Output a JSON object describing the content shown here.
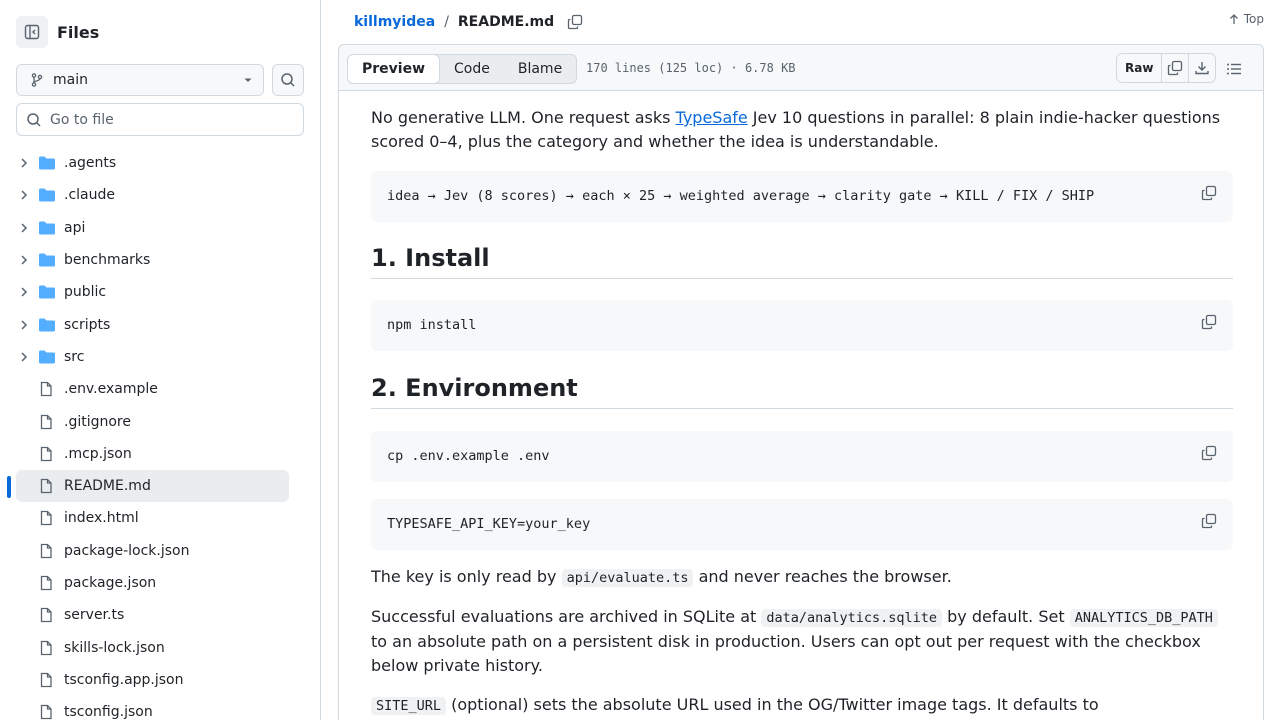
{
  "sidebar": {
    "title": "Files",
    "branch": "main",
    "goto_placeholder": "Go to file",
    "items": [
      {
        "name": ".agents",
        "type": "folder"
      },
      {
        "name": ".claude",
        "type": "folder"
      },
      {
        "name": "api",
        "type": "folder"
      },
      {
        "name": "benchmarks",
        "type": "folder"
      },
      {
        "name": "public",
        "type": "folder"
      },
      {
        "name": "scripts",
        "type": "folder"
      },
      {
        "name": "src",
        "type": "folder"
      },
      {
        "name": ".env.example",
        "type": "file"
      },
      {
        "name": ".gitignore",
        "type": "file"
      },
      {
        "name": ".mcp.json",
        "type": "file"
      },
      {
        "name": "README.md",
        "type": "file",
        "active": true
      },
      {
        "name": "index.html",
        "type": "file"
      },
      {
        "name": "package-lock.json",
        "type": "file"
      },
      {
        "name": "package.json",
        "type": "file"
      },
      {
        "name": "server.ts",
        "type": "file"
      },
      {
        "name": "skills-lock.json",
        "type": "file"
      },
      {
        "name": "tsconfig.app.json",
        "type": "file"
      },
      {
        "name": "tsconfig.json",
        "type": "file"
      }
    ]
  },
  "header": {
    "repo": "killmyidea",
    "sep": "/",
    "file": "README.md",
    "top_label": "Top"
  },
  "filebar": {
    "tabs": [
      "Preview",
      "Code",
      "Blame"
    ],
    "meta": "170 lines (125 loc) · 6.78 KB",
    "raw_label": "Raw"
  },
  "readme": {
    "intro_pre": "No generative LLM. One request asks ",
    "intro_link": "TypeSafe",
    "intro_post": " Jev 10 questions in parallel: 8 plain indie-hacker questions scored 0–4, plus the category and whether the idea is understandable.",
    "pipeline_code": "idea → Jev (8 scores) → each × 25 → weighted average → clarity gate → KILL / FIX / SHIP",
    "h_install": "1. Install",
    "install_code": "npm install",
    "h_env": "2. Environment",
    "env_code": "cp .env.example .env",
    "key_code": "TYPESAFE_API_KEY=your_key",
    "key_pre": "The key is only read by ",
    "key_inline": "api/evaluate.ts",
    "key_post": " and never reaches the browser.",
    "arch_pre": "Successful evaluations are archived in SQLite at ",
    "arch_inline1": "data/analytics.sqlite",
    "arch_mid": " by default. Set ",
    "arch_inline2": "ANALYTICS_DB_PATH",
    "arch_post": " to an absolute path on a persistent disk in production. Users can opt out per request with the checkbox below private history.",
    "site_inline": "SITE_URL",
    "site_post": " (optional) sets the absolute URL used in the OG/Twitter image tags. It defaults to"
  }
}
